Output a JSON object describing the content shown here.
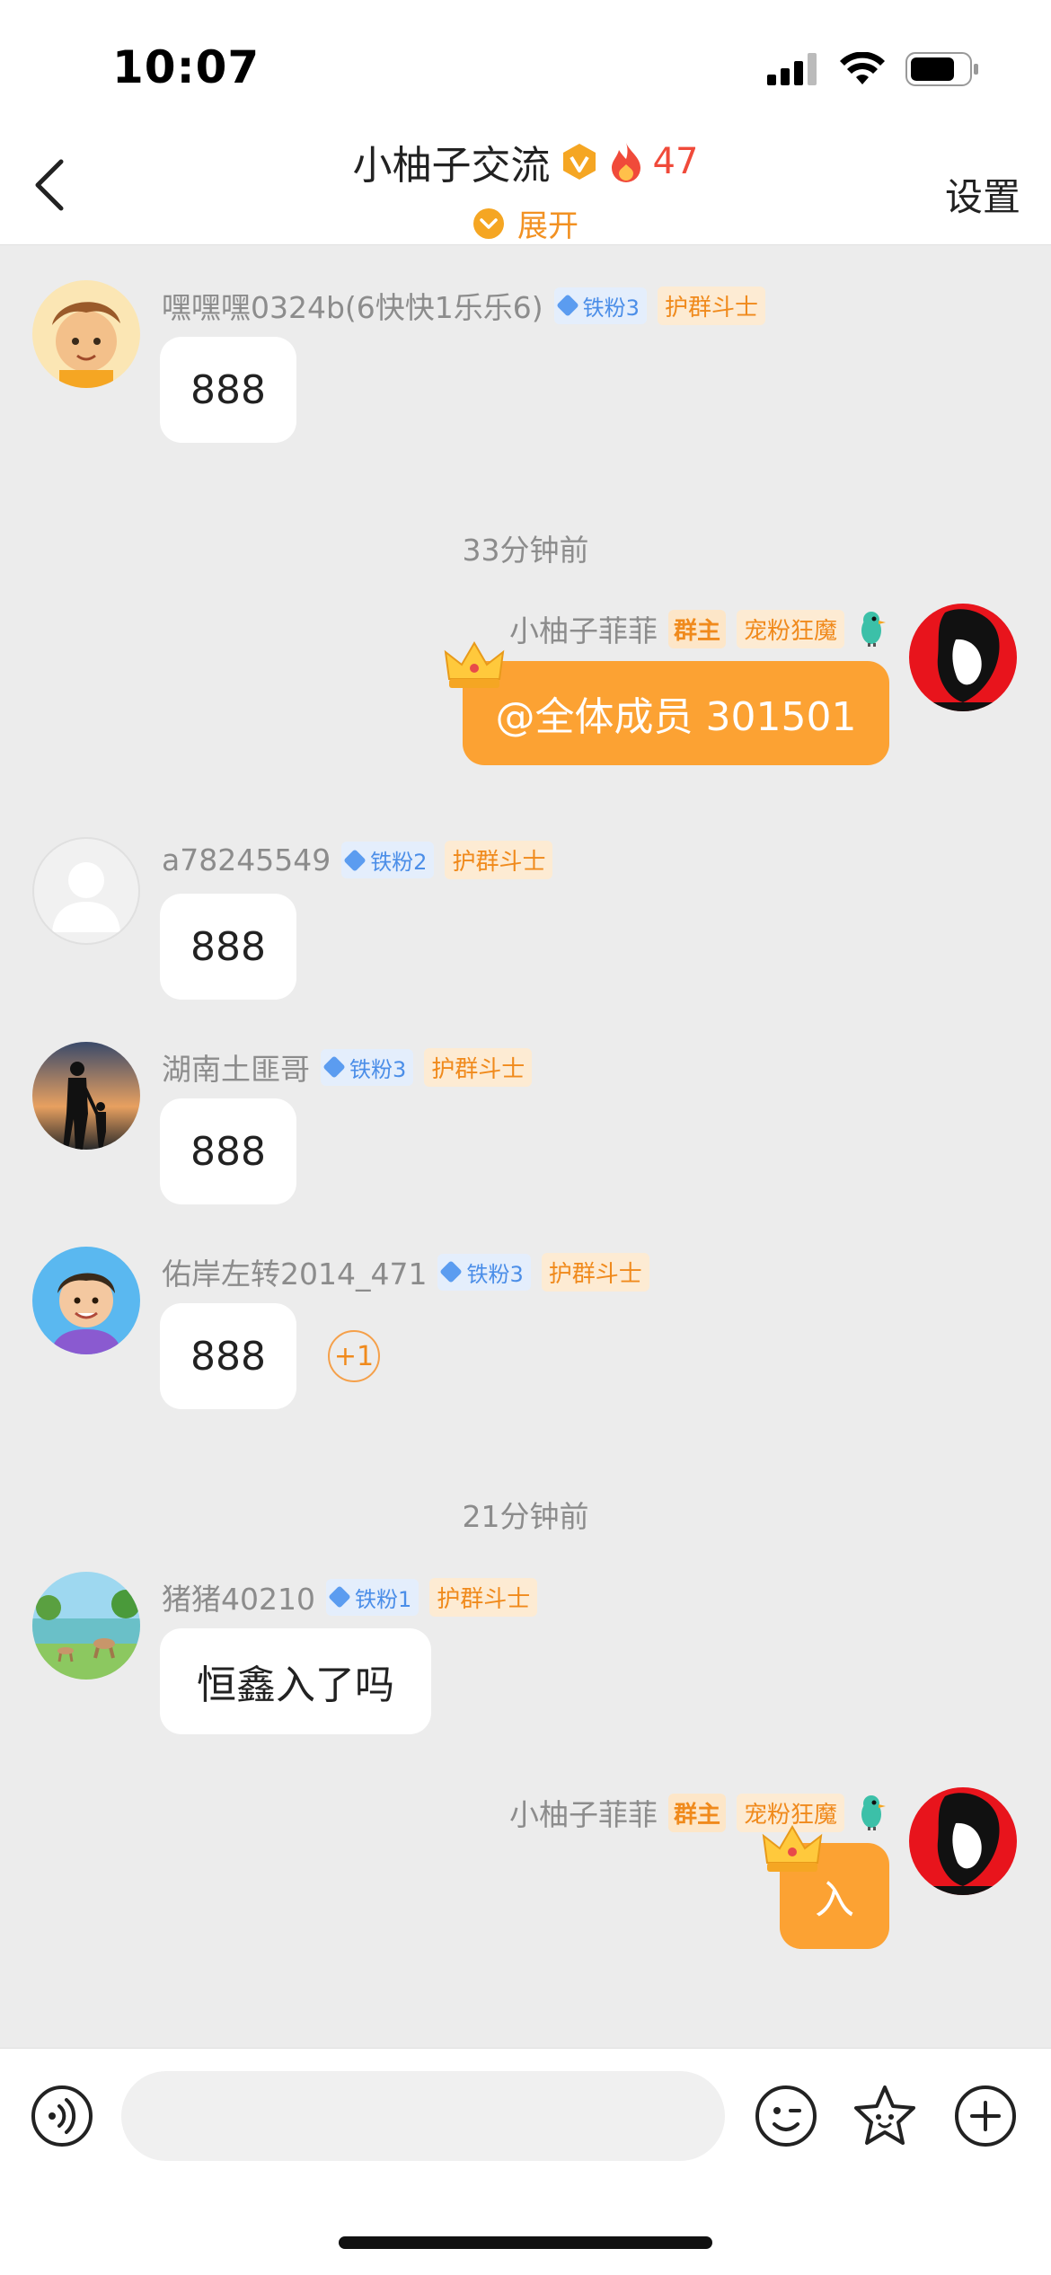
{
  "status_bar": {
    "time": "10:07"
  },
  "header": {
    "title": "小柚子交流",
    "fire_count": "47",
    "expand": "展开",
    "settings": "设置"
  },
  "messages": {
    "m1": {
      "name": "嘿嘿嘿0324b(6快快1乐乐6)",
      "fan_badge": "铁粉3",
      "guard_badge": "护群斗士",
      "text": "888"
    },
    "ts1": "33分钟前",
    "m2": {
      "name": "小柚子菲菲",
      "owner_badge": "群主",
      "pet_badge": "宠粉狂魔",
      "text": "@全体成员 301501"
    },
    "m3": {
      "name": "a78245549",
      "fan_badge": "铁粉2",
      "guard_badge": "护群斗士",
      "text": "888"
    },
    "m4": {
      "name": "湖南土匪哥",
      "fan_badge": "铁粉3",
      "guard_badge": "护群斗士",
      "text": "888"
    },
    "m5": {
      "name": "佑岸左转2014_471",
      "fan_badge": "铁粉3",
      "guard_badge": "护群斗士",
      "text": "888",
      "plus_one": "+1"
    },
    "ts2": "21分钟前",
    "m6": {
      "name": "猪猪40210",
      "fan_badge": "铁粉1",
      "guard_badge": "护群斗士",
      "text": "恒鑫入了吗"
    },
    "m7": {
      "name": "小柚子菲菲",
      "owner_badge": "群主",
      "pet_badge": "宠粉狂魔",
      "text": "入"
    }
  },
  "icons": [
    "back-icon",
    "verified-icon",
    "fire-icon",
    "expand-icon",
    "voice-icon",
    "emoji-icon",
    "sticker-icon",
    "plus-icon",
    "crown-icon",
    "bird-icon"
  ],
  "colors": {
    "accent": "#fca233",
    "fire": "#f04a3a",
    "fan_badge": "#4b8ee8",
    "guard_badge": "#f08a1c"
  }
}
